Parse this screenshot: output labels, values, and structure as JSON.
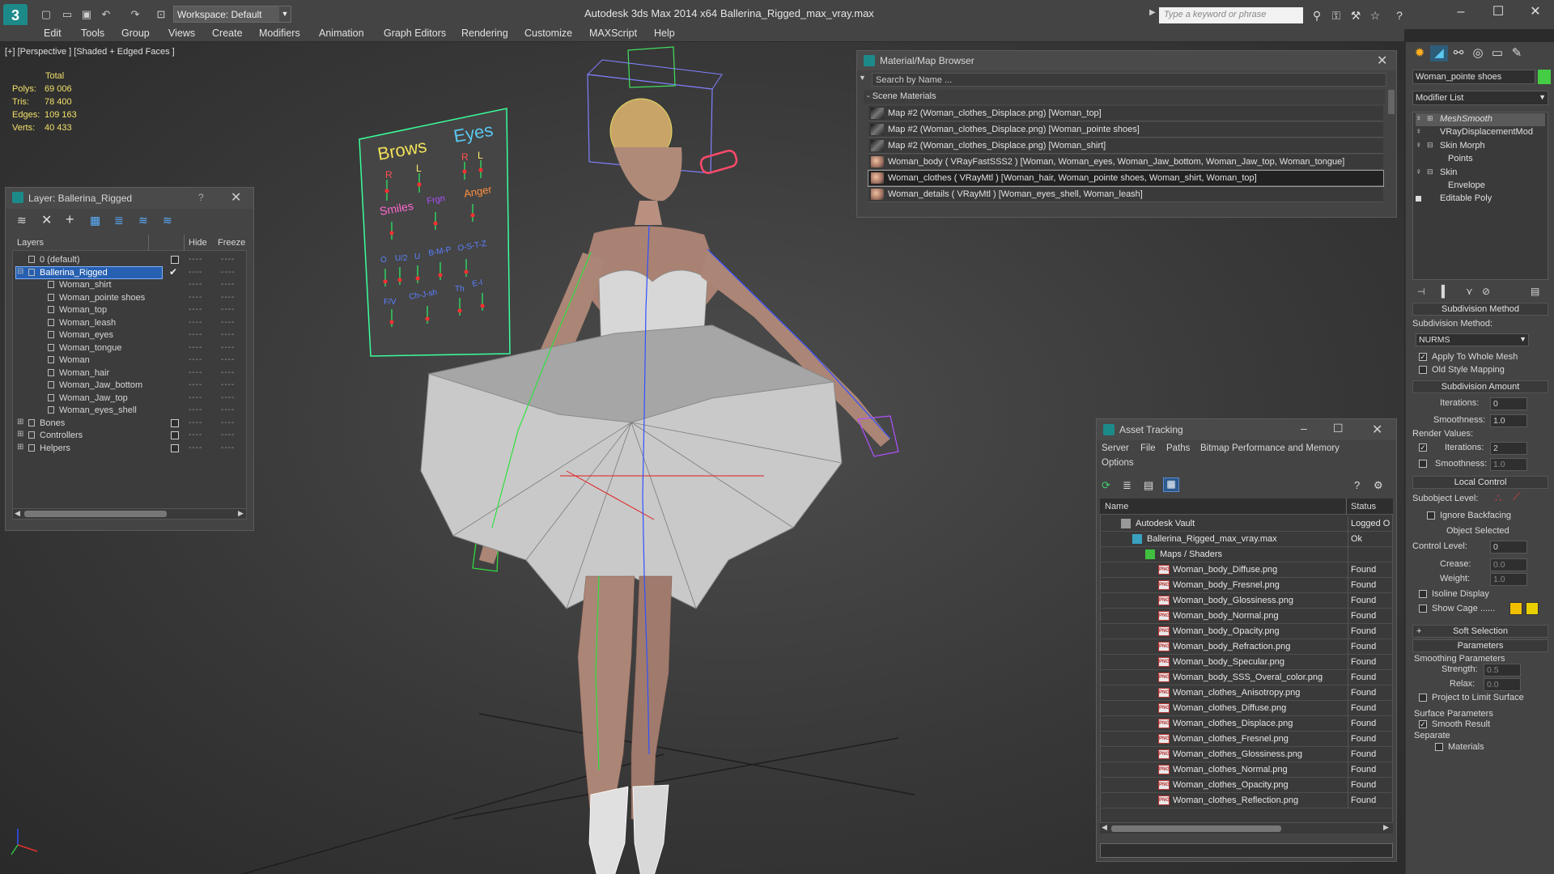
{
  "titlebar": {
    "workspace": "Workspace: Default",
    "app_title": "Autodesk 3ds Max  2014 x64",
    "file_name": "Ballerina_Rigged_max_vray.max",
    "search_placeholder": "Type a keyword or phrase"
  },
  "menu": [
    "Edit",
    "Tools",
    "Group",
    "Views",
    "Create",
    "Modifiers",
    "Animation",
    "Graph Editors",
    "Rendering",
    "Customize",
    "MAXScript",
    "Help"
  ],
  "viewport": {
    "label": "[+] [Perspective ] [Shaded + Edged Faces ]",
    "stats_header": "Total",
    "stats": [
      {
        "label": "Polys:",
        "value": "69 006"
      },
      {
        "label": "Tris:",
        "value": "78 400"
      },
      {
        "label": "Edges:",
        "value": "109 163"
      },
      {
        "label": "Verts:",
        "value": "40 433"
      }
    ],
    "face_board": {
      "brows": "Brows",
      "eyes": "Eyes",
      "r1": "R",
      "l1": "L",
      "r2": "R",
      "l2": "L",
      "smiles": "Smiles",
      "frown": "Frgn",
      "anger": "Anger",
      "phonemes": [
        "O",
        "U/2",
        "U",
        "B-M-P",
        "O-S-T-Z"
      ],
      "row3": [
        "F/V",
        "Ch-J-sh",
        "Th",
        "E-I"
      ]
    }
  },
  "layer_panel": {
    "title": "Layer: Ballerina_Rigged",
    "help": "?",
    "col_layers": "Layers",
    "col_hide": "Hide",
    "col_freeze": "Freeze",
    "rows": [
      {
        "name": "0 (default)",
        "level": 0
      },
      {
        "name": "Ballerina_Rigged",
        "level": 0
      },
      {
        "name": "Woman_shirt",
        "level": 1
      },
      {
        "name": "Woman_pointe shoes",
        "level": 1
      },
      {
        "name": "Woman_top",
        "level": 1
      },
      {
        "name": "Woman_leash",
        "level": 1
      },
      {
        "name": "Woman_eyes",
        "level": 1
      },
      {
        "name": "Woman_tongue",
        "level": 1
      },
      {
        "name": "Woman",
        "level": 1
      },
      {
        "name": "Woman_hair",
        "level": 1
      },
      {
        "name": "Woman_Jaw_bottom",
        "level": 1
      },
      {
        "name": "Woman_Jaw_top",
        "level": 1
      },
      {
        "name": "Woman_eyes_shell",
        "level": 1
      },
      {
        "name": "Bones",
        "level": 0
      },
      {
        "name": "Controllers",
        "level": 0
      },
      {
        "name": "Helpers",
        "level": 0
      }
    ]
  },
  "material_browser": {
    "title": "Material/Map Browser",
    "search": "Search by Name ...",
    "group": "- Scene Materials",
    "rows": [
      "Map #2 (Woman_clothes_Displace.png) [Woman_top]",
      "Map #2 (Woman_clothes_Displace.png) [Woman_pointe shoes]",
      "Map #2 (Woman_clothes_Displace.png) [Woman_shirt]",
      "Woman_body  ( VRayFastSSS2 )  [Woman, Woman_eyes, Woman_Jaw_bottom, Woman_Jaw_top, Woman_tongue]",
      "Woman_clothes  ( VRayMtl )  [Woman_hair, Woman_pointe shoes, Woman_shirt, Woman_top]",
      "Woman_details  ( VRayMtl )  [Woman_eyes_shell, Woman_leash]"
    ]
  },
  "asset_tracking": {
    "title": "Asset Tracking",
    "menu": [
      "Server",
      "File",
      "Paths",
      "Bitmap Performance and Memory",
      "Options"
    ],
    "col_name": "Name",
    "col_status": "Status",
    "rows": [
      {
        "name": "Autodesk Vault",
        "status": "Logged O"
      },
      {
        "name": "Ballerina_Rigged_max_vray.max",
        "status": "Ok"
      },
      {
        "name": "Maps / Shaders",
        "status": ""
      },
      {
        "name": "Woman_body_Diffuse.png",
        "status": "Found"
      },
      {
        "name": "Woman_body_Fresnel.png",
        "status": "Found"
      },
      {
        "name": "Woman_body_Glossiness.png",
        "status": "Found"
      },
      {
        "name": "Woman_body_Normal.png",
        "status": "Found"
      },
      {
        "name": "Woman_body_Opacity.png",
        "status": "Found"
      },
      {
        "name": "Woman_body_Refraction.png",
        "status": "Found"
      },
      {
        "name": "Woman_body_Specular.png",
        "status": "Found"
      },
      {
        "name": "Woman_body_SSS_Overal_color.png",
        "status": "Found"
      },
      {
        "name": "Woman_clothes_Anisotropy.png",
        "status": "Found"
      },
      {
        "name": "Woman_clothes_Diffuse.png",
        "status": "Found"
      },
      {
        "name": "Woman_clothes_Displace.png",
        "status": "Found"
      },
      {
        "name": "Woman_clothes_Fresnel.png",
        "status": "Found"
      },
      {
        "name": "Woman_clothes_Glossiness.png",
        "status": "Found"
      },
      {
        "name": "Woman_clothes_Normal.png",
        "status": "Found"
      },
      {
        "name": "Woman_clothes_Opacity.png",
        "status": "Found"
      },
      {
        "name": "Woman_clothes_Reflection.png",
        "status": "Found"
      }
    ]
  },
  "command_panel": {
    "object_name": "Woman_pointe shoes",
    "modifier_list": "Modifier List",
    "stack": [
      {
        "name": "MeshSmooth",
        "indent": 0
      },
      {
        "name": "VRayDisplacementMod",
        "indent": 0
      },
      {
        "name": "Skin Morph",
        "indent": 0
      },
      {
        "name": "Points",
        "indent": 1
      },
      {
        "name": "Skin",
        "indent": 0
      },
      {
        "name": "Envelope",
        "indent": 1
      },
      {
        "name": "Editable Poly",
        "indent": 0
      }
    ],
    "subdiv_method_title": "Subdivision Method",
    "subdiv_method_label": "Subdivision Method:",
    "subdiv_method_value": "NURMS",
    "apply_whole_mesh": "Apply To Whole Mesh",
    "old_style_mapping": "Old Style Mapping",
    "subdiv_amount_title": "Subdivision Amount",
    "iterations_label": "Iterations:",
    "iterations_value": "0",
    "smoothness_label": "Smoothness:",
    "smoothness_value": "1.0",
    "render_values": "Render Values:",
    "r_iterations_label": "Iterations:",
    "r_iterations_value": "2",
    "r_smoothness_label": "Smoothness:",
    "r_smoothness_value": "1.0",
    "local_control_title": "Local Control",
    "subobject_level": "Subobject Level:",
    "ignore_backfacing": "Ignore Backfacing",
    "object_selected": "Object Selected",
    "control_level_label": "Control Level:",
    "control_level_value": "0",
    "crease_label": "Crease:",
    "crease_value": "0.0",
    "weight_label": "Weight:",
    "weight_value": "1.0",
    "isoline_display": "Isoline Display",
    "show_cage": "Show Cage ......",
    "soft_selection_title": "Soft Selection",
    "parameters_title": "Parameters",
    "smoothing_params": "Smoothing Parameters",
    "strength_label": "Strength:",
    "strength_value": "0.5",
    "relax_label": "Relax:",
    "relax_value": "0.0",
    "project_limit": "Project to Limit Surface",
    "surface_params": "Surface Parameters",
    "smooth_result": "Smooth Result",
    "separate": "Separate",
    "materials": "Materials",
    "colors": {
      "cage_a": "#f0c000",
      "cage_b": "#e8d000",
      "accent": "#1d8a8a"
    }
  }
}
